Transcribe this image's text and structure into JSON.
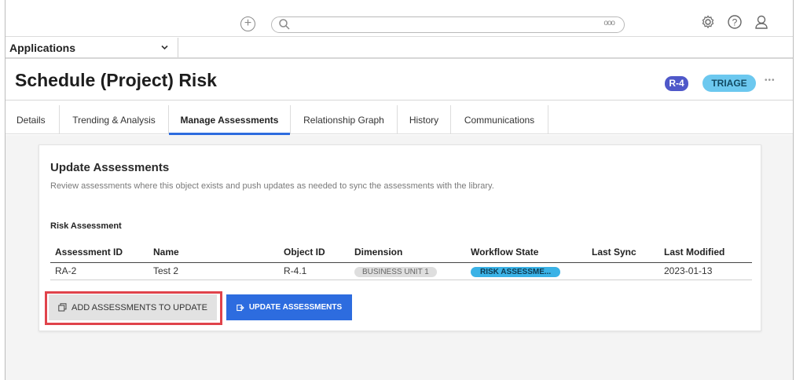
{
  "topbar": {
    "add_icon": "plus-circle-icon",
    "search_placeholder": "",
    "search_options_label": "ooo",
    "icons": [
      "gear-icon",
      "help-icon",
      "user-icon"
    ]
  },
  "app_selector": {
    "label": "Applications"
  },
  "header": {
    "title": "Schedule (Project) Risk",
    "object_id_badge": "R-4",
    "state_badge": "TRIAGE",
    "more_label": "•••"
  },
  "tabs": [
    {
      "label": "Details"
    },
    {
      "label": "Trending & Analysis"
    },
    {
      "label": "Manage Assessments",
      "active": true
    },
    {
      "label": "Relationship Graph"
    },
    {
      "label": "History"
    },
    {
      "label": "Communications"
    }
  ],
  "card": {
    "title": "Update Assessments",
    "description": "Review assessments where this object exists and push updates as needed to sync the assessments with the library.",
    "section_label": "Risk Assessment",
    "columns": [
      "Assessment ID",
      "Name",
      "Object ID",
      "Dimension",
      "Workflow State",
      "Last Sync",
      "Last Modified"
    ],
    "rows": [
      {
        "assessment_id": "RA-2",
        "name": "Test 2",
        "object_id": "R-4.1",
        "dimension": "BUSINESS UNIT 1",
        "workflow_state": "RISK ASSESSME...",
        "last_sync": "",
        "last_modified": "2023-01-13"
      }
    ],
    "add_button_label": "ADD ASSESSMENTS TO UPDATE",
    "update_button_label": "UPDATE ASSESSMENTS"
  },
  "colors": {
    "accent": "#2d6cdf",
    "id_badge": "#4f58c9",
    "state_badge": "#6cc8ef",
    "highlight": "#e0434b"
  }
}
